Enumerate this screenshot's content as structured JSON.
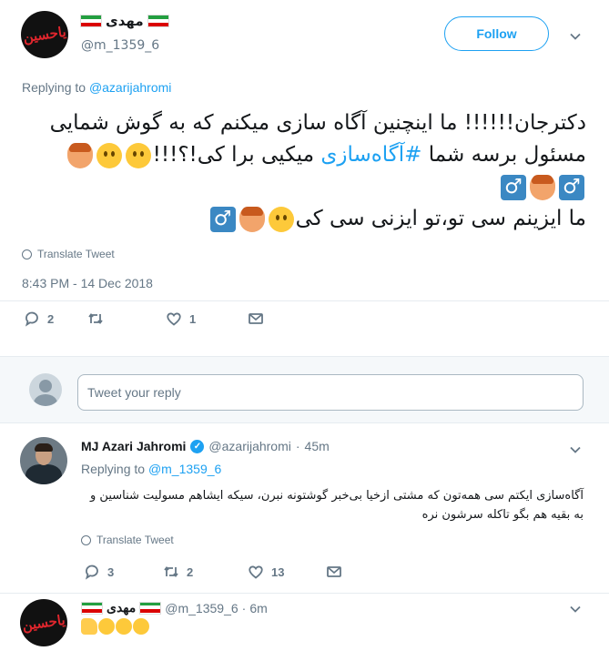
{
  "main_tweet": {
    "display_name": "مهدی",
    "handle": "@m_1359_6",
    "avatar_text": "یاحسین",
    "follow_label": "Follow",
    "replying_prefix": "Replying to",
    "replying_handle": "@azarijahromi",
    "text_line1": "دکترجان!!!!!! ما اینچنین آگاه سازی میکنم که به گوش شمایی",
    "text_line2_a": "مسئول برسه شما ",
    "text_line2_tag": "#آگاه‌سازی",
    "text_line2_b": " میکیی برا کی!؟!!!",
    "text_line3": "ما ایزینم سی تو،تو ایزنی سی کی",
    "male_sign": "♂",
    "translate_label": "Translate Tweet",
    "timestamp": "8:43 PM - 14 Dec 2018",
    "reply_count": "2",
    "retweet_count": "",
    "like_count": "1"
  },
  "reply_box": {
    "placeholder": "Tweet your reply"
  },
  "reply_1": {
    "name": "MJ Azari Jahromi",
    "verified_mark": "✓",
    "handle": "@azarijahromi",
    "dot": "·",
    "time": "45m",
    "replying_prefix": "Replying to",
    "replying_handle": "@m_1359_6",
    "text": "آگاه‌سازی ایکتم سی همه‌تون که مشتی ازخیا بی‌خبر گوشتونه نبرن، سیکه ایشاهم مسولیت شناسین و به بقیه هم بگو تاکله سرشون نره",
    "translate_label": "Translate Tweet",
    "reply_count": "3",
    "retweet_count": "2",
    "like_count": "13"
  },
  "reply_2": {
    "display_name": "مهدی",
    "handle": "@m_1359_6",
    "dot": "·",
    "time": "6m",
    "avatar_text": "یاحسین"
  },
  "colors": {
    "accent": "#1da1f2",
    "muted": "#657786",
    "text": "#14171a",
    "divider": "#e6ecf0"
  }
}
